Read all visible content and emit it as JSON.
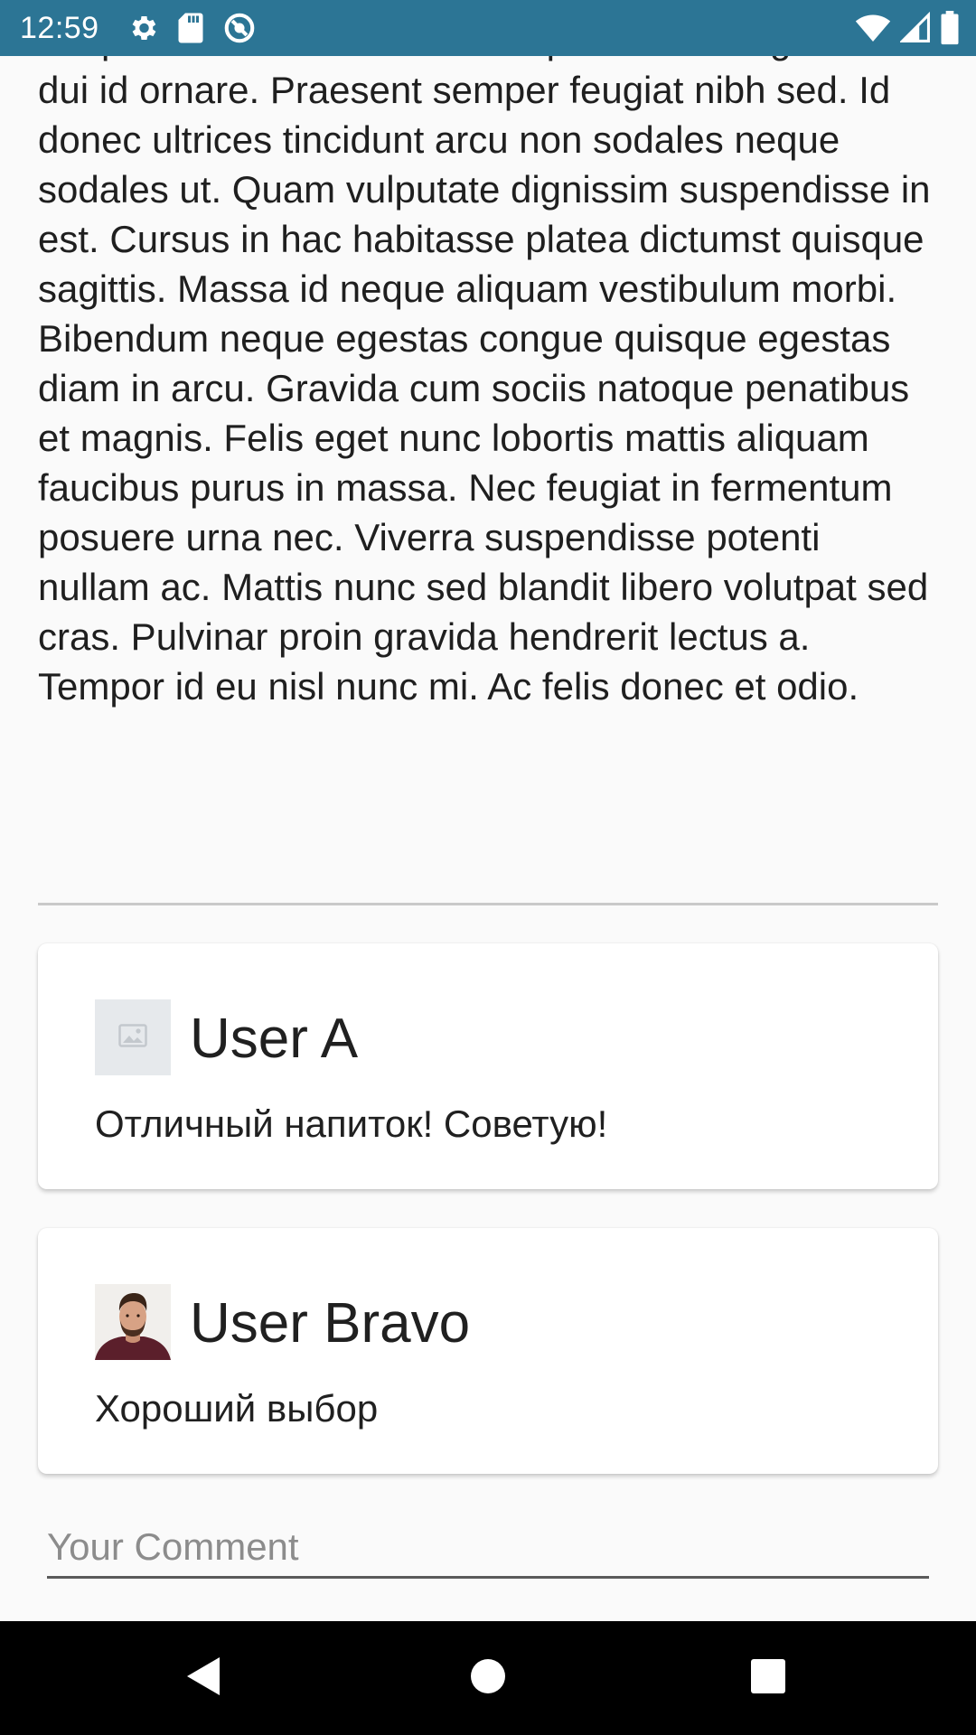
{
  "status_bar": {
    "time": "12:59",
    "left_icons": [
      "settings-icon",
      "sd-card-icon",
      "data-saver-icon"
    ],
    "right_icons": [
      "wifi-icon",
      "cell-signal-icon",
      "battery-icon"
    ],
    "background_color": "#2c7595"
  },
  "article": {
    "body": "tempor id eu. Vel facilisis volutpat est velit egestas dui id ornare. Praesent semper feugiat nibh sed. Id donec ultrices tincidunt arcu non sodales neque sodales ut. Quam vulputate dignissim suspendisse in est. Cursus in hac habitasse platea dictumst quisque sagittis. Massa id neque aliquam vestibulum morbi. Bibendum neque egestas congue quisque egestas diam in arcu. Gravida cum sociis natoque penatibus et magnis. Felis eget nunc lobortis mattis aliquam faucibus purus in massa. Nec feugiat in fermentum posuere urna nec. Viverra suspendisse potenti nullam ac. Mattis nunc sed blandit libero volutpat sed cras. Pulvinar proin gravida hendrerit lectus a. Tempor id eu nisl nunc mi. Ac felis donec et odio."
  },
  "comments": [
    {
      "user": "User A",
      "avatar": "image-placeholder-icon",
      "text": "Отличный напиток! Советую!"
    },
    {
      "user": "User Bravo",
      "avatar": "user-photo",
      "text": "Хороший выбор"
    }
  ],
  "comment_input": {
    "placeholder": "Your Comment",
    "value": ""
  },
  "nav_bar": {
    "buttons": [
      "back-icon",
      "home-icon",
      "recents-icon"
    ]
  }
}
